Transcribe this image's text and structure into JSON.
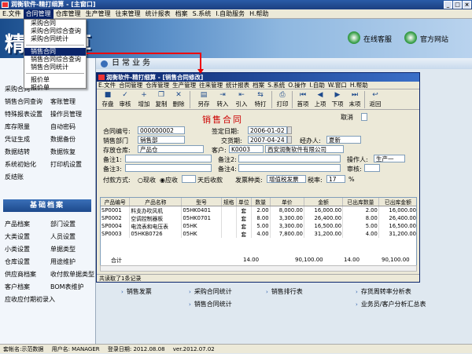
{
  "window_title": "润衡软件-精打细算 - [主窗口]",
  "menu": [
    "E.文件",
    "合同管理",
    "仓库管理",
    "生产管理",
    "往来管理",
    "统计报表",
    "档案",
    "S.系统",
    "I.自助服务",
    "H.帮助"
  ],
  "dropdown": {
    "group1": [
      "采购合同",
      "采购合同综合查询",
      "采购合同统计"
    ],
    "group2": [
      "销售合同",
      "销售合同综合查询",
      "销售合同统计"
    ],
    "group3": [
      "报价单",
      "报价单"
    ]
  },
  "banner": {
    "logo": "精打细算",
    "support": "在线客服",
    "website": "官方网站"
  },
  "main_title": "日常业务",
  "sidebar": {
    "top_item": "采购合同",
    "items": [
      "销售合同查询",
      "客账管理",
      "特殊报表设置",
      "操作员管理",
      "库存限量",
      "自动密码",
      "凭证生成",
      "数据备份",
      "数据结转",
      "数据恢复",
      "系统初始化",
      "打印机设置",
      "反结账"
    ],
    "archive_head": "基础档案",
    "archive_items": [
      "产品档案",
      "部门设置",
      "大类设置",
      "人员设置",
      "小类设置",
      "单据类型",
      "仓库设置",
      "用途维护",
      "供应商档案",
      "收付款单据类型",
      "客户档案",
      "BOM表维护",
      "应收应付期初录入"
    ]
  },
  "bottom_links": [
    "销售发票",
    "采购合同统计",
    "销售排行表",
    "存货周转率分析表",
    "销售合同统计",
    "业务员/客户分析汇总表"
  ],
  "child": {
    "title": "润衡软件-精打细算 - [销售合同修改]",
    "menu": [
      "E.文件",
      "合同管理",
      "仓库管理",
      "生产管理",
      "往来管理",
      "统计报表",
      "档案",
      "S.系统",
      "O.操作",
      "I.自助",
      "W.窗口",
      "H.帮助"
    ],
    "toolbar": [
      {
        "icon": "save-icon",
        "glyph": "■",
        "label": "存盘"
      },
      {
        "icon": "audit-icon",
        "glyph": "✓",
        "label": "审核"
      },
      {
        "icon": "add-icon",
        "glyph": "+",
        "label": "增加"
      },
      {
        "icon": "copy-icon",
        "glyph": "❐",
        "label": "复制"
      },
      {
        "icon": "delete-icon",
        "glyph": "✕",
        "label": "删除"
      },
      {
        "icon": "save-as-icon",
        "glyph": "▤",
        "label": "另存"
      },
      {
        "icon": "transfer-in-icon",
        "glyph": "⇥",
        "label": "转入"
      },
      {
        "icon": "import-icon",
        "glyph": "⇤",
        "label": "引入"
      },
      {
        "icon": "special-import-icon",
        "glyph": "⇆",
        "label": "特打"
      },
      {
        "icon": "print-icon",
        "glyph": "⎙",
        "label": "打印"
      },
      {
        "icon": "first-icon",
        "glyph": "⏮",
        "label": "首项"
      },
      {
        "icon": "prev-icon",
        "glyph": "◀",
        "label": "上项"
      },
      {
        "icon": "next-icon",
        "glyph": "▶",
        "label": "下项"
      },
      {
        "icon": "last-icon",
        "glyph": "⏭",
        "label": "末项"
      },
      {
        "icon": "back-icon",
        "glyph": "↩",
        "label": "返回"
      }
    ],
    "form": {
      "heading": "销售合同",
      "cancel_label": "取消",
      "contract_no_label": "合同编号:",
      "contract_no": "000000002",
      "sign_date_label": "签定日期:",
      "sign_date": "2006-01-02",
      "dept_label": "销售部门",
      "dept": "销售部",
      "delivery_label": "交货期:",
      "delivery": "2007-04-24",
      "manager_label": "经办人:",
      "manager": "夏新",
      "warehouse_label": "存放仓库:",
      "warehouse": "产品仓",
      "customer_label": "客户:",
      "customer_code": "K0003",
      "customer_name": "西安润衡软件有限公司",
      "note1_label": "备注1:",
      "note2_label": "备注2:",
      "note3_label": "备注3:",
      "note4_label": "备注4:",
      "operator_label": "操作人:",
      "operator": "生产一",
      "auditor_label": "审核:",
      "payment_label": "付款方式:",
      "pay_cash": "现收",
      "pay_receivable": "应收",
      "days_suffix": "天后收款",
      "invoice_label": "发票种类:",
      "invoice": "增值税发票",
      "tax_label": "税率:",
      "tax": "17",
      "tax_unit": "%"
    },
    "grid": {
      "headers": [
        "产品编号",
        "产品名称",
        "型号",
        "规格",
        "单位",
        "数量",
        "单价",
        "金额",
        "已出库数量",
        "已出库金额"
      ],
      "rows": [
        [
          "SP0001",
          "料支办吹风机",
          "05HK0401",
          "",
          "套",
          "2.00",
          "8,000.00",
          "16,000.00",
          "2.00",
          "16,000.00"
        ],
        [
          "SP0002",
          "空调控制器板",
          "05HK0701",
          "",
          "套",
          "8.00",
          "3,300.00",
          "26,400.00",
          "8.00",
          "26,400.00"
        ],
        [
          "SP0004",
          "电流表和电压表",
          "05HK",
          "",
          "套",
          "5.00",
          "3,300.00",
          "16,500.00",
          "5.00",
          "16,500.00"
        ],
        [
          "SP0003",
          "05HKB0726",
          "05HK",
          "",
          "套",
          "4.00",
          "7,800.00",
          "31,200.00",
          "4.00",
          "31,200.00"
        ]
      ],
      "total_label": "合计",
      "total_qty": "14.00",
      "total_amount": "90,100.00",
      "total_out_qty": "14.00",
      "total_out_amount": "90,100.00"
    },
    "status": "共读取了1条记录"
  },
  "statusbar": {
    "account": "套帐名:示范数据",
    "user": "用户名: MANAGER",
    "login": "登录日期: 2012.08.08",
    "version": "ver.2012.07.02"
  }
}
